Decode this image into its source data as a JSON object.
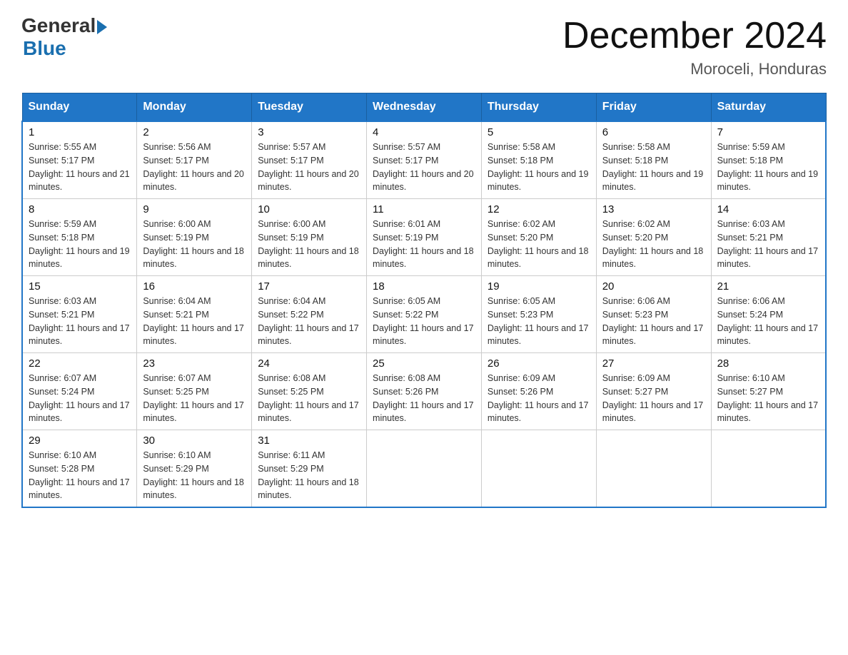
{
  "header": {
    "logo_general": "General",
    "logo_blue": "Blue",
    "title": "December 2024",
    "subtitle": "Moroceli, Honduras"
  },
  "calendar": {
    "days_of_week": [
      "Sunday",
      "Monday",
      "Tuesday",
      "Wednesday",
      "Thursday",
      "Friday",
      "Saturday"
    ],
    "weeks": [
      [
        {
          "day": "1",
          "sunrise": "5:55 AM",
          "sunset": "5:17 PM",
          "daylight": "11 hours and 21 minutes."
        },
        {
          "day": "2",
          "sunrise": "5:56 AM",
          "sunset": "5:17 PM",
          "daylight": "11 hours and 20 minutes."
        },
        {
          "day": "3",
          "sunrise": "5:57 AM",
          "sunset": "5:17 PM",
          "daylight": "11 hours and 20 minutes."
        },
        {
          "day": "4",
          "sunrise": "5:57 AM",
          "sunset": "5:17 PM",
          "daylight": "11 hours and 20 minutes."
        },
        {
          "day": "5",
          "sunrise": "5:58 AM",
          "sunset": "5:18 PM",
          "daylight": "11 hours and 19 minutes."
        },
        {
          "day": "6",
          "sunrise": "5:58 AM",
          "sunset": "5:18 PM",
          "daylight": "11 hours and 19 minutes."
        },
        {
          "day": "7",
          "sunrise": "5:59 AM",
          "sunset": "5:18 PM",
          "daylight": "11 hours and 19 minutes."
        }
      ],
      [
        {
          "day": "8",
          "sunrise": "5:59 AM",
          "sunset": "5:18 PM",
          "daylight": "11 hours and 19 minutes."
        },
        {
          "day": "9",
          "sunrise": "6:00 AM",
          "sunset": "5:19 PM",
          "daylight": "11 hours and 18 minutes."
        },
        {
          "day": "10",
          "sunrise": "6:00 AM",
          "sunset": "5:19 PM",
          "daylight": "11 hours and 18 minutes."
        },
        {
          "day": "11",
          "sunrise": "6:01 AM",
          "sunset": "5:19 PM",
          "daylight": "11 hours and 18 minutes."
        },
        {
          "day": "12",
          "sunrise": "6:02 AM",
          "sunset": "5:20 PM",
          "daylight": "11 hours and 18 minutes."
        },
        {
          "day": "13",
          "sunrise": "6:02 AM",
          "sunset": "5:20 PM",
          "daylight": "11 hours and 18 minutes."
        },
        {
          "day": "14",
          "sunrise": "6:03 AM",
          "sunset": "5:21 PM",
          "daylight": "11 hours and 17 minutes."
        }
      ],
      [
        {
          "day": "15",
          "sunrise": "6:03 AM",
          "sunset": "5:21 PM",
          "daylight": "11 hours and 17 minutes."
        },
        {
          "day": "16",
          "sunrise": "6:04 AM",
          "sunset": "5:21 PM",
          "daylight": "11 hours and 17 minutes."
        },
        {
          "day": "17",
          "sunrise": "6:04 AM",
          "sunset": "5:22 PM",
          "daylight": "11 hours and 17 minutes."
        },
        {
          "day": "18",
          "sunrise": "6:05 AM",
          "sunset": "5:22 PM",
          "daylight": "11 hours and 17 minutes."
        },
        {
          "day": "19",
          "sunrise": "6:05 AM",
          "sunset": "5:23 PM",
          "daylight": "11 hours and 17 minutes."
        },
        {
          "day": "20",
          "sunrise": "6:06 AM",
          "sunset": "5:23 PM",
          "daylight": "11 hours and 17 minutes."
        },
        {
          "day": "21",
          "sunrise": "6:06 AM",
          "sunset": "5:24 PM",
          "daylight": "11 hours and 17 minutes."
        }
      ],
      [
        {
          "day": "22",
          "sunrise": "6:07 AM",
          "sunset": "5:24 PM",
          "daylight": "11 hours and 17 minutes."
        },
        {
          "day": "23",
          "sunrise": "6:07 AM",
          "sunset": "5:25 PM",
          "daylight": "11 hours and 17 minutes."
        },
        {
          "day": "24",
          "sunrise": "6:08 AM",
          "sunset": "5:25 PM",
          "daylight": "11 hours and 17 minutes."
        },
        {
          "day": "25",
          "sunrise": "6:08 AM",
          "sunset": "5:26 PM",
          "daylight": "11 hours and 17 minutes."
        },
        {
          "day": "26",
          "sunrise": "6:09 AM",
          "sunset": "5:26 PM",
          "daylight": "11 hours and 17 minutes."
        },
        {
          "day": "27",
          "sunrise": "6:09 AM",
          "sunset": "5:27 PM",
          "daylight": "11 hours and 17 minutes."
        },
        {
          "day": "28",
          "sunrise": "6:10 AM",
          "sunset": "5:27 PM",
          "daylight": "11 hours and 17 minutes."
        }
      ],
      [
        {
          "day": "29",
          "sunrise": "6:10 AM",
          "sunset": "5:28 PM",
          "daylight": "11 hours and 17 minutes."
        },
        {
          "day": "30",
          "sunrise": "6:10 AM",
          "sunset": "5:29 PM",
          "daylight": "11 hours and 18 minutes."
        },
        {
          "day": "31",
          "sunrise": "6:11 AM",
          "sunset": "5:29 PM",
          "daylight": "11 hours and 18 minutes."
        },
        null,
        null,
        null,
        null
      ]
    ]
  }
}
